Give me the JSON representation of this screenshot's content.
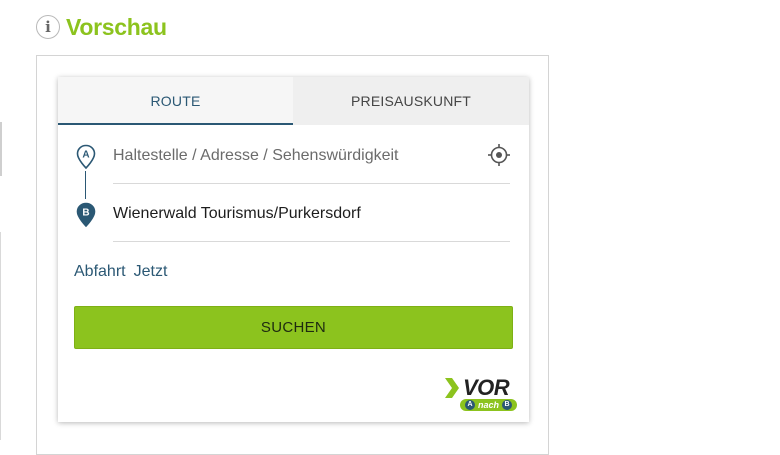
{
  "header": {
    "info_icon": "info-icon",
    "info_glyph": "i",
    "title": "Vorschau"
  },
  "widget": {
    "tabs": [
      {
        "label": "ROUTE",
        "active": true
      },
      {
        "label": "PREISAUSKUNFT",
        "active": false
      }
    ],
    "from": {
      "marker": "A",
      "value": "",
      "placeholder": "Haltestelle / Adresse / Sehenswürdigkeit",
      "action_icon": "locate-crosshair-icon"
    },
    "to": {
      "marker": "B",
      "value": "Wienerwald Tourismus/Purkersdorf",
      "placeholder": ""
    },
    "time": {
      "mode": "Abfahrt",
      "value": "Jetzt"
    },
    "search_button": "SUCHEN",
    "logo": {
      "word": "VOR",
      "tagline_a": "A",
      "tagline_mid": "nach",
      "tagline_b": "B"
    },
    "colors": {
      "accent_green": "#8cc31e",
      "primary_blue": "#2b5874"
    }
  }
}
